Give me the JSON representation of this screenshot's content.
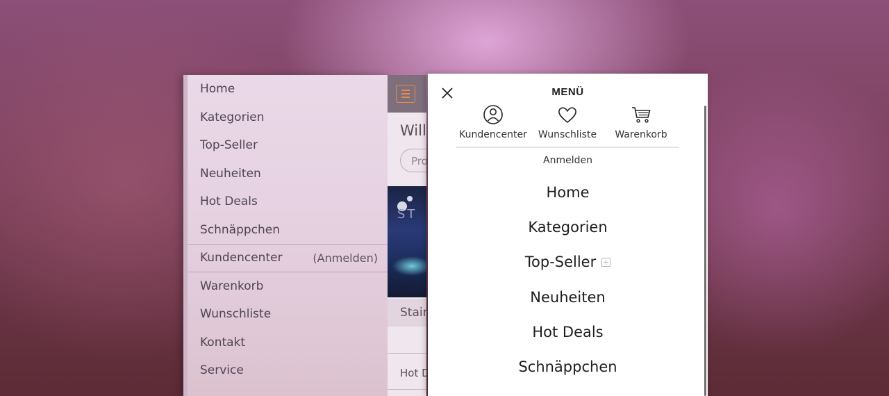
{
  "left_menu": {
    "items": [
      {
        "label": "Home"
      },
      {
        "label": "Kategorien"
      },
      {
        "label": "Top-Seller"
      },
      {
        "label": "Neuheiten"
      },
      {
        "label": "Hot Deals"
      },
      {
        "label": "Schnäppchen"
      },
      {
        "label": "Kundencenter",
        "sub": "(Anmelden)"
      },
      {
        "label": "Warenkorb"
      },
      {
        "label": "Wunschliste"
      },
      {
        "label": "Kontakt"
      },
      {
        "label": "Service"
      }
    ]
  },
  "peek": {
    "heading": "Will",
    "pill": "Pro",
    "logo_text": "ST",
    "stair": "Stair",
    "hot": "Hot D"
  },
  "mobile_menu": {
    "title": "MENÜ",
    "quick_links": [
      {
        "label": "Kundencenter",
        "icon": "user-icon"
      },
      {
        "label": "Wunschliste",
        "icon": "heart-icon"
      },
      {
        "label": "Warenkorb",
        "icon": "cart-icon"
      }
    ],
    "login_label": "Anmelden",
    "nav": [
      {
        "label": "Home"
      },
      {
        "label": "Kategorien"
      },
      {
        "label": "Top-Seller",
        "expandable": true
      },
      {
        "label": "Neuheiten"
      },
      {
        "label": "Hot Deals"
      },
      {
        "label": "Schnäppchen"
      }
    ]
  },
  "colors": {
    "accent_orange": "#e98a4c",
    "panel_white": "#ffffff"
  }
}
